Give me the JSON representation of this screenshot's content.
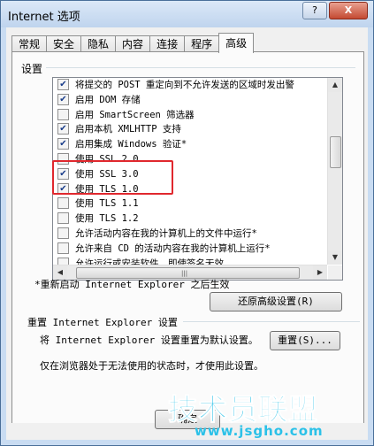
{
  "window": {
    "title": "Internet 选项",
    "help_label": "?",
    "close_label": "X"
  },
  "tabs": [
    "常规",
    "安全",
    "隐私",
    "内容",
    "连接",
    "程序",
    "高级"
  ],
  "settings": {
    "group_label": "设置",
    "items": [
      {
        "label": "将提交的 POST 重定向到不允许发送的区域时发出警",
        "checked": true
      },
      {
        "label": "启用 DOM 存储",
        "checked": true
      },
      {
        "label": "启用 SmartScreen 筛选器",
        "checked": false
      },
      {
        "label": "启用本机 XMLHTTP 支持",
        "checked": true
      },
      {
        "label": "启用集成 Windows 验证*",
        "checked": true
      },
      {
        "label": "使用 SSL 2.0",
        "checked": false
      },
      {
        "label": "使用 SSL 3.0",
        "checked": true
      },
      {
        "label": "使用 TLS 1.0",
        "checked": true
      },
      {
        "label": "使用 TLS 1.1",
        "checked": false
      },
      {
        "label": "使用 TLS 1.2",
        "checked": false
      },
      {
        "label": "允许活动内容在我的计算机上的文件中运行*",
        "checked": false
      },
      {
        "label": "允许来自 CD 的活动内容在我的计算机上运行*",
        "checked": false
      },
      {
        "label": "允许运行或安装软件，即使签名无效",
        "checked": false
      }
    ],
    "restart_note": "*重新启动 Internet Explorer 之后生效",
    "restore_button": "还原高级设置(R)"
  },
  "reset": {
    "group_label": "重置 Internet Explorer 设置",
    "description": "将 Internet Explorer 设置重置为默认设置。",
    "reset_button": "重置(S)...",
    "note": "仅在浏览器处于无法使用的状态时，才使用此设置。"
  },
  "footer": {
    "ok_button": "确定"
  },
  "watermark": {
    "main": "技术员联盟",
    "sub": "www.jsgho.com"
  },
  "colors": {
    "highlight_box": "#e0282e",
    "watermark": "#2bc1e8",
    "checkmark": "#1a3d8a"
  }
}
